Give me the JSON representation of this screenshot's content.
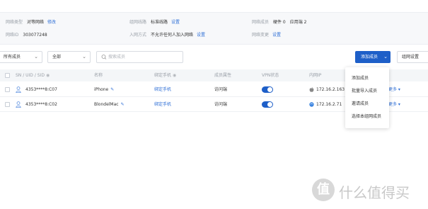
{
  "info": {
    "net_type_label": "网络类型",
    "net_type_value": "对等网络",
    "net_type_action": "修改",
    "net_id_label": "网络ID",
    "net_id_value": "303077248",
    "line_label": "组网线路",
    "line_value": "标准线路",
    "line_action": "设置",
    "join_label": "入网方式",
    "join_value": "不允许任何人加入网络",
    "join_action": "设置",
    "status_label": "网络成员",
    "status_online": "硬件 0",
    "status_apps": "应用端 2",
    "change_label": "网络变更",
    "change_action": "设置"
  },
  "toolbar": {
    "member_filter": "所有成员",
    "type_filter": "全部",
    "search_placeholder": "搜索成员",
    "add_member": "添加成员",
    "view_settings": "组网设置"
  },
  "table": {
    "headers": [
      "SN / UID / SID",
      "名称",
      "绑定手机",
      "成员属性",
      "VPN状态",
      "内网IP"
    ],
    "rows": [
      {
        "id": "4353****8:C07",
        "name": "iPhone",
        "phone": "绑定手机",
        "attr": "访问端",
        "ip": "172.16.2.163",
        "os": "apple"
      },
      {
        "id": "4353****8:C02",
        "name": "BlondelMac",
        "phone": "绑定手机",
        "attr": "访问端",
        "ip": "172.16.2.71",
        "os": "mac"
      }
    ],
    "more": "更多"
  },
  "menu": {
    "items": [
      "添加成员",
      "批量导入成员",
      "邀请成员",
      "选择本组网成员"
    ]
  },
  "watermark": {
    "logo_text": "值",
    "text": "什么值得买"
  },
  "colors": {
    "accent": "#1e5fc8",
    "link": "#2f6fd6"
  }
}
